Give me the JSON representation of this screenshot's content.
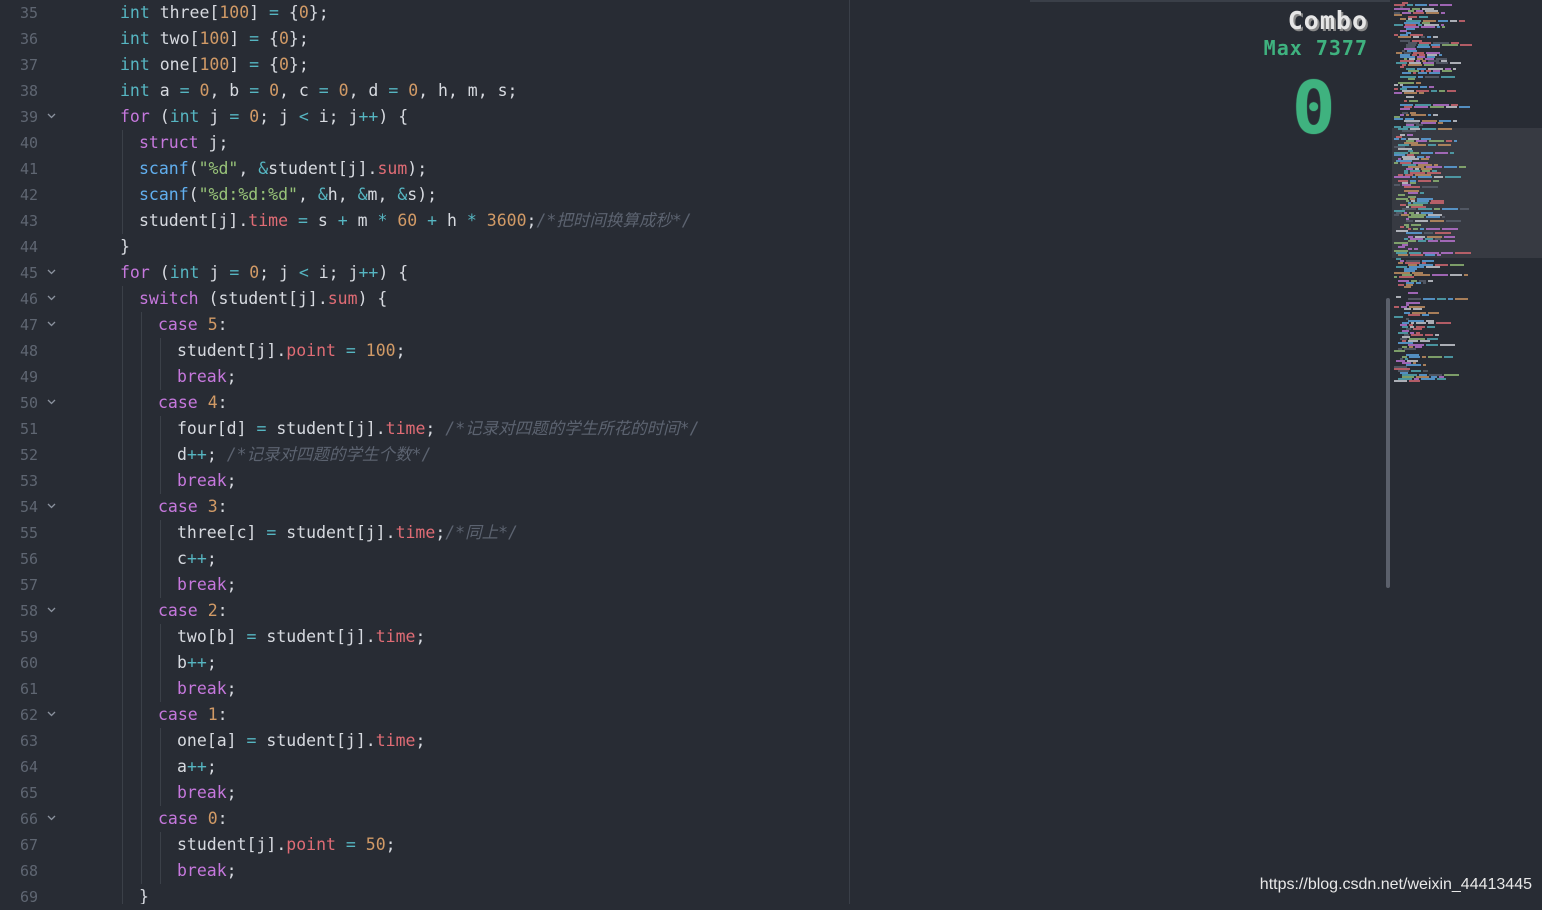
{
  "editor": {
    "theme_colors": {
      "background": "#282c34",
      "keyword": "#c678dd",
      "type": "#56b6c2",
      "number": "#d19a66",
      "string": "#98c379",
      "function": "#61afef",
      "property": "#e06c75",
      "comment": "#5c6370",
      "plain": "#d7dae0",
      "line_number": "#5f6672"
    },
    "fold_icon": "chevron-down-icon",
    "lines": [
      {
        "n": "35",
        "fold": false,
        "indent": 2,
        "tokens": [
          [
            "type",
            "int"
          ],
          [
            "pl",
            " three["
          ],
          [
            "num",
            "100"
          ],
          [
            "pl",
            "] "
          ],
          [
            "op",
            "="
          ],
          [
            "pl",
            " {"
          ],
          [
            "num",
            "0"
          ],
          [
            "pl",
            "};"
          ]
        ]
      },
      {
        "n": "36",
        "fold": false,
        "indent": 2,
        "tokens": [
          [
            "type",
            "int"
          ],
          [
            "pl",
            " two["
          ],
          [
            "num",
            "100"
          ],
          [
            "pl",
            "] "
          ],
          [
            "op",
            "="
          ],
          [
            "pl",
            " {"
          ],
          [
            "num",
            "0"
          ],
          [
            "pl",
            "};"
          ]
        ]
      },
      {
        "n": "37",
        "fold": false,
        "indent": 2,
        "tokens": [
          [
            "type",
            "int"
          ],
          [
            "pl",
            " one["
          ],
          [
            "num",
            "100"
          ],
          [
            "pl",
            "] "
          ],
          [
            "op",
            "="
          ],
          [
            "pl",
            " {"
          ],
          [
            "num",
            "0"
          ],
          [
            "pl",
            "};"
          ]
        ]
      },
      {
        "n": "38",
        "fold": false,
        "indent": 2,
        "tokens": [
          [
            "type",
            "int"
          ],
          [
            "pl",
            " a "
          ],
          [
            "op",
            "="
          ],
          [
            "pl",
            " "
          ],
          [
            "num",
            "0"
          ],
          [
            "pl",
            ", b "
          ],
          [
            "op",
            "="
          ],
          [
            "pl",
            " "
          ],
          [
            "num",
            "0"
          ],
          [
            "pl",
            ", c "
          ],
          [
            "op",
            "="
          ],
          [
            "pl",
            " "
          ],
          [
            "num",
            "0"
          ],
          [
            "pl",
            ", d "
          ],
          [
            "op",
            "="
          ],
          [
            "pl",
            " "
          ],
          [
            "num",
            "0"
          ],
          [
            "pl",
            ", h, m, s;"
          ]
        ]
      },
      {
        "n": "39",
        "fold": true,
        "indent": 2,
        "tokens": [
          [
            "kw",
            "for"
          ],
          [
            "pl",
            " ("
          ],
          [
            "type",
            "int"
          ],
          [
            "pl",
            " j "
          ],
          [
            "op",
            "="
          ],
          [
            "pl",
            " "
          ],
          [
            "num",
            "0"
          ],
          [
            "pl",
            "; j "
          ],
          [
            "op",
            "<"
          ],
          [
            "pl",
            " i; j"
          ],
          [
            "op",
            "++"
          ],
          [
            "pl",
            ") {"
          ]
        ]
      },
      {
        "n": "40",
        "fold": false,
        "indent": 3,
        "tokens": [
          [
            "kw",
            "struct"
          ],
          [
            "pl",
            " j;"
          ]
        ]
      },
      {
        "n": "41",
        "fold": false,
        "indent": 3,
        "tokens": [
          [
            "fn",
            "scanf"
          ],
          [
            "pl",
            "("
          ],
          [
            "str",
            "\"%d\""
          ],
          [
            "pl",
            ", "
          ],
          [
            "op",
            "&"
          ],
          [
            "pl",
            "student[j]."
          ],
          [
            "prop",
            "sum"
          ],
          [
            "pl",
            ");"
          ]
        ]
      },
      {
        "n": "42",
        "fold": false,
        "indent": 3,
        "tokens": [
          [
            "fn",
            "scanf"
          ],
          [
            "pl",
            "("
          ],
          [
            "str",
            "\"%d:%d:%d\""
          ],
          [
            "pl",
            ", "
          ],
          [
            "op",
            "&"
          ],
          [
            "pl",
            "h, "
          ],
          [
            "op",
            "&"
          ],
          [
            "pl",
            "m, "
          ],
          [
            "op",
            "&"
          ],
          [
            "pl",
            "s);"
          ]
        ]
      },
      {
        "n": "43",
        "fold": false,
        "indent": 3,
        "tokens": [
          [
            "pl",
            "student[j]."
          ],
          [
            "prop",
            "time"
          ],
          [
            "pl",
            " "
          ],
          [
            "op",
            "="
          ],
          [
            "pl",
            " s "
          ],
          [
            "op",
            "+"
          ],
          [
            "pl",
            " m "
          ],
          [
            "op",
            "*"
          ],
          [
            "pl",
            " "
          ],
          [
            "num",
            "60"
          ],
          [
            "pl",
            " "
          ],
          [
            "op",
            "+"
          ],
          [
            "pl",
            " h "
          ],
          [
            "op",
            "*"
          ],
          [
            "pl",
            " "
          ],
          [
            "num",
            "3600"
          ],
          [
            "pl",
            ";"
          ],
          [
            "cm",
            "/*把时间换算成秒*/"
          ]
        ]
      },
      {
        "n": "44",
        "fold": false,
        "indent": 2,
        "tokens": [
          [
            "pl",
            "}"
          ]
        ]
      },
      {
        "n": "45",
        "fold": true,
        "indent": 2,
        "tokens": [
          [
            "kw",
            "for"
          ],
          [
            "pl",
            " ("
          ],
          [
            "type",
            "int"
          ],
          [
            "pl",
            " j "
          ],
          [
            "op",
            "="
          ],
          [
            "pl",
            " "
          ],
          [
            "num",
            "0"
          ],
          [
            "pl",
            "; j "
          ],
          [
            "op",
            "<"
          ],
          [
            "pl",
            " i; j"
          ],
          [
            "op",
            "++"
          ],
          [
            "pl",
            ") {"
          ]
        ]
      },
      {
        "n": "46",
        "fold": true,
        "indent": 3,
        "tokens": [
          [
            "kw",
            "switch"
          ],
          [
            "pl",
            " (student[j]."
          ],
          [
            "prop",
            "sum"
          ],
          [
            "pl",
            ") {"
          ]
        ]
      },
      {
        "n": "47",
        "fold": true,
        "indent": 4,
        "tokens": [
          [
            "kw",
            "case"
          ],
          [
            "pl",
            " "
          ],
          [
            "num",
            "5"
          ],
          [
            "pl",
            ":"
          ]
        ]
      },
      {
        "n": "48",
        "fold": false,
        "indent": 5,
        "tokens": [
          [
            "pl",
            "student[j]."
          ],
          [
            "prop",
            "point"
          ],
          [
            "pl",
            " "
          ],
          [
            "op",
            "="
          ],
          [
            "pl",
            " "
          ],
          [
            "num",
            "100"
          ],
          [
            "pl",
            ";"
          ]
        ]
      },
      {
        "n": "49",
        "fold": false,
        "indent": 5,
        "tokens": [
          [
            "kw",
            "break"
          ],
          [
            "pl",
            ";"
          ]
        ]
      },
      {
        "n": "50",
        "fold": true,
        "indent": 4,
        "tokens": [
          [
            "kw",
            "case"
          ],
          [
            "pl",
            " "
          ],
          [
            "num",
            "4"
          ],
          [
            "pl",
            ":"
          ]
        ]
      },
      {
        "n": "51",
        "fold": false,
        "indent": 5,
        "tokens": [
          [
            "pl",
            "four[d] "
          ],
          [
            "op",
            "="
          ],
          [
            "pl",
            " student[j]."
          ],
          [
            "prop",
            "time"
          ],
          [
            "pl",
            "; "
          ],
          [
            "cm",
            "/*记录对四题的学生所花的时间*/"
          ]
        ]
      },
      {
        "n": "52",
        "fold": false,
        "indent": 5,
        "tokens": [
          [
            "pl",
            "d"
          ],
          [
            "op",
            "++"
          ],
          [
            "pl",
            "; "
          ],
          [
            "cm",
            "/*记录对四题的学生个数*/"
          ]
        ]
      },
      {
        "n": "53",
        "fold": false,
        "indent": 5,
        "tokens": [
          [
            "kw",
            "break"
          ],
          [
            "pl",
            ";"
          ]
        ]
      },
      {
        "n": "54",
        "fold": true,
        "indent": 4,
        "tokens": [
          [
            "kw",
            "case"
          ],
          [
            "pl",
            " "
          ],
          [
            "num",
            "3"
          ],
          [
            "pl",
            ":"
          ]
        ]
      },
      {
        "n": "55",
        "fold": false,
        "indent": 5,
        "tokens": [
          [
            "pl",
            "three[c] "
          ],
          [
            "op",
            "="
          ],
          [
            "pl",
            " student[j]."
          ],
          [
            "prop",
            "time"
          ],
          [
            "pl",
            ";"
          ],
          [
            "cm",
            "/*同上*/"
          ]
        ]
      },
      {
        "n": "56",
        "fold": false,
        "indent": 5,
        "tokens": [
          [
            "pl",
            "c"
          ],
          [
            "op",
            "++"
          ],
          [
            "pl",
            ";"
          ]
        ]
      },
      {
        "n": "57",
        "fold": false,
        "indent": 5,
        "tokens": [
          [
            "kw",
            "break"
          ],
          [
            "pl",
            ";"
          ]
        ]
      },
      {
        "n": "58",
        "fold": true,
        "indent": 4,
        "tokens": [
          [
            "kw",
            "case"
          ],
          [
            "pl",
            " "
          ],
          [
            "num",
            "2"
          ],
          [
            "pl",
            ":"
          ]
        ]
      },
      {
        "n": "59",
        "fold": false,
        "indent": 5,
        "tokens": [
          [
            "pl",
            "two[b] "
          ],
          [
            "op",
            "="
          ],
          [
            "pl",
            " student[j]."
          ],
          [
            "prop",
            "time"
          ],
          [
            "pl",
            ";"
          ]
        ]
      },
      {
        "n": "60",
        "fold": false,
        "indent": 5,
        "tokens": [
          [
            "pl",
            "b"
          ],
          [
            "op",
            "++"
          ],
          [
            "pl",
            ";"
          ]
        ]
      },
      {
        "n": "61",
        "fold": false,
        "indent": 5,
        "tokens": [
          [
            "kw",
            "break"
          ],
          [
            "pl",
            ";"
          ]
        ]
      },
      {
        "n": "62",
        "fold": true,
        "indent": 4,
        "tokens": [
          [
            "kw",
            "case"
          ],
          [
            "pl",
            " "
          ],
          [
            "num",
            "1"
          ],
          [
            "pl",
            ":"
          ]
        ]
      },
      {
        "n": "63",
        "fold": false,
        "indent": 5,
        "tokens": [
          [
            "pl",
            "one[a] "
          ],
          [
            "op",
            "="
          ],
          [
            "pl",
            " student[j]."
          ],
          [
            "prop",
            "time"
          ],
          [
            "pl",
            ";"
          ]
        ]
      },
      {
        "n": "64",
        "fold": false,
        "indent": 5,
        "tokens": [
          [
            "pl",
            "a"
          ],
          [
            "op",
            "++"
          ],
          [
            "pl",
            ";"
          ]
        ]
      },
      {
        "n": "65",
        "fold": false,
        "indent": 5,
        "tokens": [
          [
            "kw",
            "break"
          ],
          [
            "pl",
            ";"
          ]
        ]
      },
      {
        "n": "66",
        "fold": true,
        "indent": 4,
        "tokens": [
          [
            "kw",
            "case"
          ],
          [
            "pl",
            " "
          ],
          [
            "num",
            "0"
          ],
          [
            "pl",
            ":"
          ]
        ]
      },
      {
        "n": "67",
        "fold": false,
        "indent": 5,
        "tokens": [
          [
            "pl",
            "student[j]."
          ],
          [
            "prop",
            "point"
          ],
          [
            "pl",
            " "
          ],
          [
            "op",
            "="
          ],
          [
            "pl",
            " "
          ],
          [
            "num",
            "50"
          ],
          [
            "pl",
            ";"
          ]
        ]
      },
      {
        "n": "68",
        "fold": false,
        "indent": 5,
        "tokens": [
          [
            "kw",
            "break"
          ],
          [
            "pl",
            ";"
          ]
        ]
      },
      {
        "n": "69",
        "fold": false,
        "indent": 3,
        "tokens": [
          [
            "pl",
            "}"
          ]
        ]
      }
    ]
  },
  "combo": {
    "title": "Combo",
    "max_label": "Max 7377",
    "count": "0",
    "color": "#3fb27f"
  },
  "watermark": {
    "text": "https://blog.csdn.net/weixin_44413445"
  }
}
